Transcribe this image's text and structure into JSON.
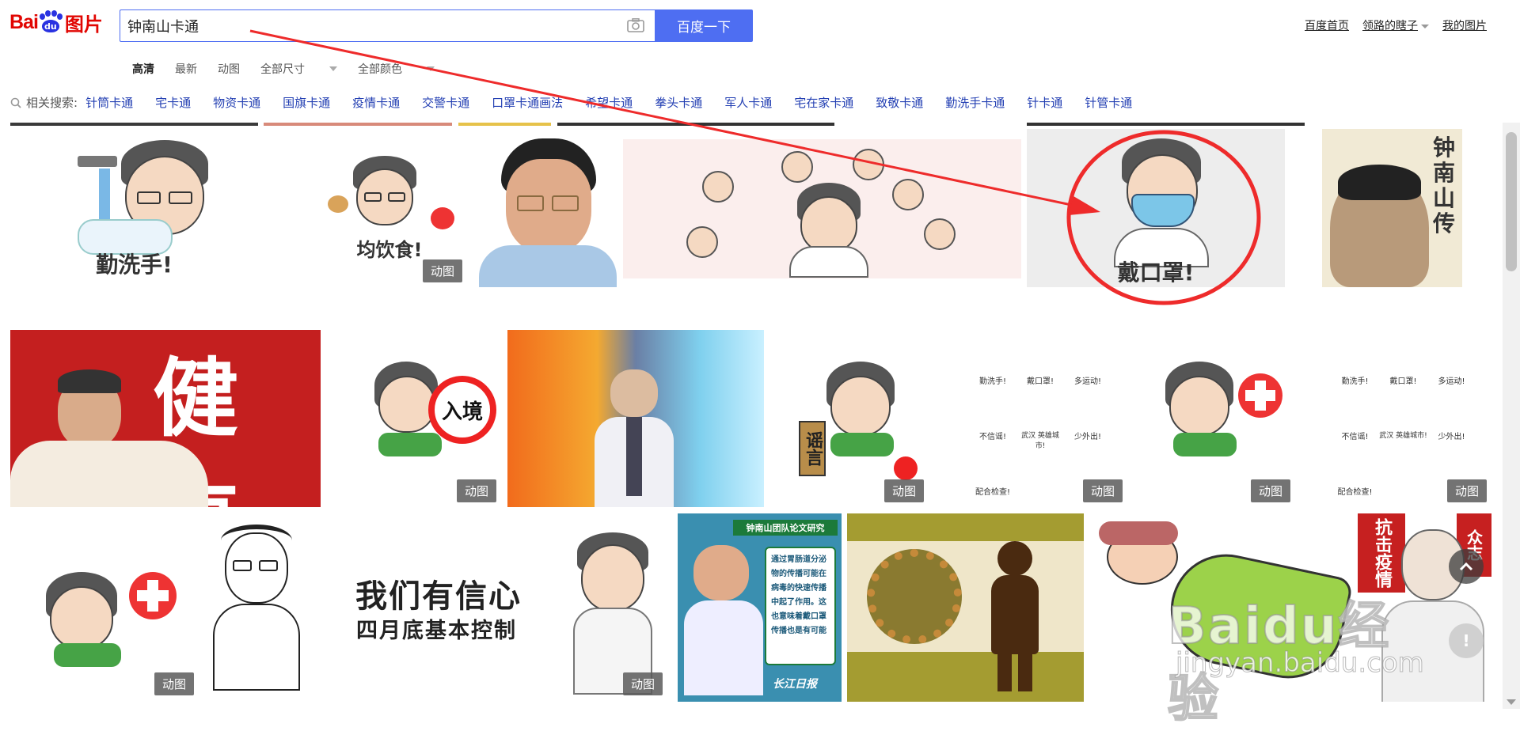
{
  "header": {
    "logo_text_bai": "Bai",
    "logo_text_du": "du",
    "logo_text_tupian": "图片",
    "search_value": "钟南山卡通",
    "search_button": "百度一下",
    "top_links": [
      {
        "label": "百度首页",
        "caret": false
      },
      {
        "label": "领路的瞎子",
        "caret": true
      },
      {
        "label": "我的图片",
        "caret": false
      }
    ]
  },
  "filters": [
    {
      "label": "高清",
      "active": true,
      "caret": false
    },
    {
      "label": "最新",
      "active": false,
      "caret": false
    },
    {
      "label": "动图",
      "active": false,
      "caret": false
    },
    {
      "label": "全部尺寸",
      "active": false,
      "caret": true
    },
    {
      "label": "全部颜色",
      "active": false,
      "caret": true
    }
  ],
  "related": {
    "label": "相关搜索:",
    "tags": [
      "针筒卡通",
      "宅卡通",
      "物资卡通",
      "国旗卡通",
      "疫情卡通",
      "交警卡通",
      "口罩卡通画法",
      "希望卡通",
      "拳头卡通",
      "军人卡通",
      "宅在家卡通",
      "致敬卡通",
      "勤洗手卡通",
      "针卡通",
      "针管卡通"
    ]
  },
  "tiles": {
    "t1_caption": "勤洗手!",
    "t2_caption": "均饮食!",
    "t2_badge": "动图",
    "t5_caption": "戴口罩!",
    "t6_title": "钟南山传",
    "t7_sign": "健康",
    "t8_sign": "入境",
    "t8_badge": "动图",
    "t10_sign": "谣言",
    "t10_badge": "动图",
    "t11_labels": [
      "勤洗手!",
      "戴口罩!",
      "多运动!",
      "不信谣!",
      "武汉 英雄城市!",
      "少外出!",
      "配合检查!"
    ],
    "t11_badge": "动图",
    "t12_badge": "动图",
    "t13_labels": [
      "勤洗手!",
      "戴口罩!",
      "多运动!",
      "不信谣!",
      "武汉 英雄城市!",
      "少外出!",
      "配合检查!"
    ],
    "t13_badge": "动图",
    "t14_badge": "动图",
    "t16_line1": "我们有信心",
    "t16_line2": "四月底基本控制",
    "t17_badge": "动图",
    "t18_title": "钟南山团队论文研究",
    "t18_body": "通过胃肠道分泌物的传播可能在病毒的快速传播中起了作用。这也意味着戴口罩传播也是有可能",
    "t18_logo": "长江日报",
    "t21_text": "抗击疫情",
    "t21_text2": "众志"
  },
  "watermark": {
    "text": "Baidu经验",
    "url": "jingyan.baidu.com"
  },
  "colors": {
    "brand_red": "#e10602",
    "brand_blue": "#4e6ef2",
    "link_blue": "#2440b3",
    "annotation_red": "#ee2b2b"
  },
  "icons": {
    "camera": "camera-icon",
    "search": "search-icon",
    "to_top": "chevron-up-icon"
  }
}
